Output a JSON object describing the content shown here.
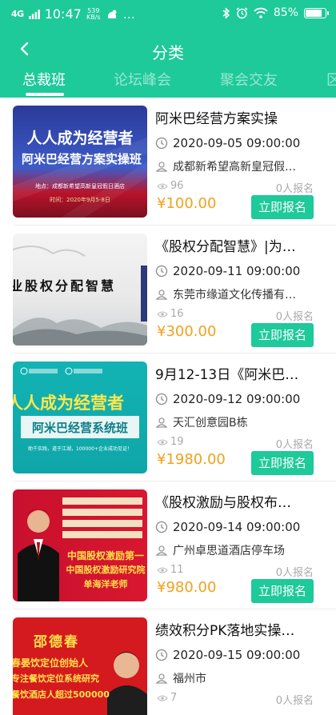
{
  "status_bar": {
    "signal": "4G",
    "time": "10:47",
    "speed": "539\nKB/s",
    "extra": "…",
    "battery": "85%",
    "battery_level": 0.85
  },
  "header": {
    "title": "分类",
    "tabs": [
      {
        "label": "总裁班",
        "active": true
      },
      {
        "label": "论坛峰会",
        "active": false
      },
      {
        "label": "聚会交友",
        "active": false
      },
      {
        "label": "区",
        "active": false
      }
    ]
  },
  "colors": {
    "accent": "#1ec99a",
    "price": "#f0a21b"
  },
  "items": [
    {
      "title": "阿米巴经营方案实操",
      "time": "2020-09-05 09:00:00",
      "place": "成都新希望高新皇冠假…",
      "views": "96",
      "signups": "0人报名",
      "price": "¥100.00",
      "button": "立即报名",
      "thumb": {
        "line1": "人人成为经营者",
        "line2": "阿米巴经营方案实操班",
        "line3": "地点：成都新希望高新皇冠假日酒店",
        "line4": "时间：2020年9月5-8日"
      }
    },
    {
      "title": "《股权分配智慧》|为…",
      "time": "2020-09-11 09:00:00",
      "place": "东莞市缘道文化传播有…",
      "views": "16",
      "signups": "0人报名",
      "price": "¥300.00",
      "button": "立即报名",
      "thumb": {
        "line1": "业股权分配智慧"
      }
    },
    {
      "title": "9月12-13日《阿米巴…",
      "time": "2020-09-12 09:00:00",
      "place": "天汇创意园B栋",
      "views": "19",
      "signups": "0人报名",
      "price": "¥1980.00",
      "button": "立即报名",
      "thumb": {
        "line1": "人人成为经营者",
        "line2": "阿米巴经营系统班",
        "line3": "助千实践，道于江湖，100000+企业成功见证！"
      }
    },
    {
      "title": "《股权激励与股权布…",
      "time": "2020-09-14 09:00:00",
      "place": "广州卓思道酒店停车场",
      "views": "11",
      "signups": "0人报名",
      "price": "¥980.00",
      "button": "立即报名",
      "thumb": {
        "line1": "中国股权激励第一",
        "line2": "中国股权激励研究院",
        "line3": "单海洋老师"
      }
    },
    {
      "title": "绩效积分PK落地实操…",
      "time": "2020-09-15 09:00:00",
      "place": "福州市",
      "views": "7",
      "signups": "0人报名",
      "price": "",
      "button": "",
      "thumb": {
        "line1": "邵德春",
        "line2": "春晏饮定位创始人",
        "line3": "专注餐饮定位系统研究",
        "line4": "餐饮酒店人超过500000"
      }
    }
  ]
}
